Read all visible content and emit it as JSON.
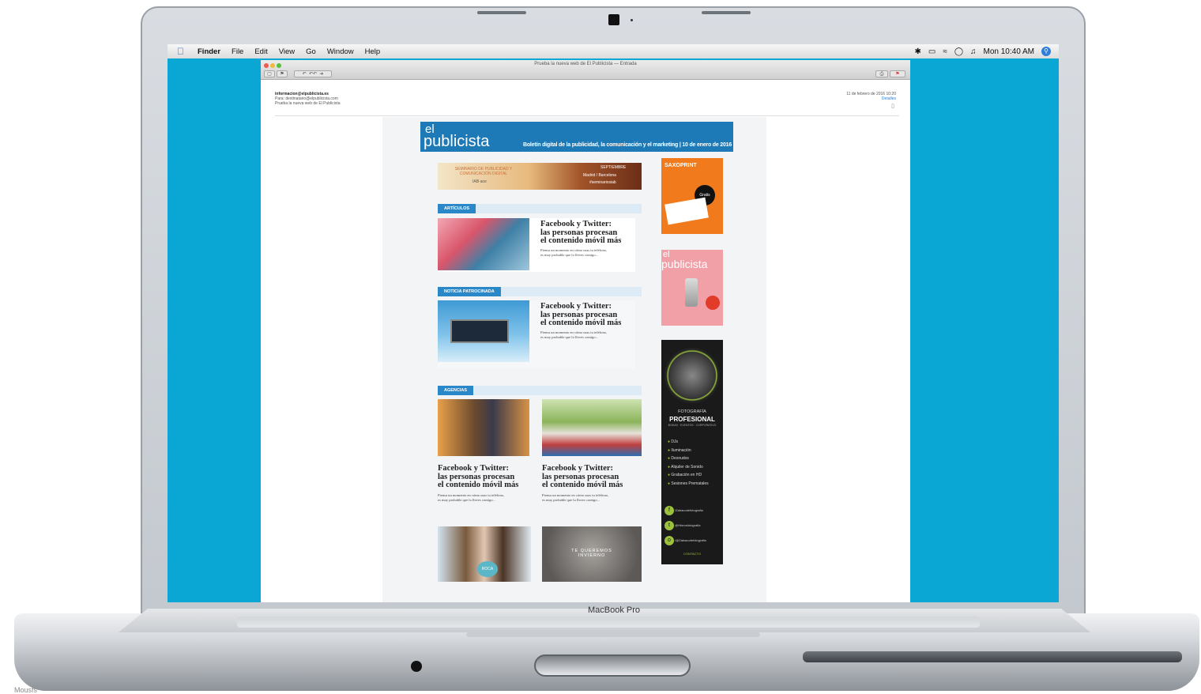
{
  "menubar": {
    "apple": "",
    "items": [
      "Finder",
      "File",
      "Edit",
      "View",
      "Go",
      "Window",
      "Help"
    ],
    "clock": "Mon 10:40 AM",
    "status_icons": [
      "bluetooth-icon",
      "battery-icon",
      "wifi-icon",
      "timemachine-icon",
      "volume-icon",
      "spotlight-icon"
    ]
  },
  "mail": {
    "window_title": "Prueba la nueva web de El Publicista — Entrada",
    "from": "informacion@elpublicista.es",
    "to": "Para: destinatario@elpublicista.com",
    "subject": "Prueba la nueva web de El Publicista",
    "date": "11 de febrero de 2016 10:20",
    "details_link": "Detalles"
  },
  "newsletter": {
    "logo_line1": "el",
    "logo_line2": "publicista",
    "tagline": "Boletín digital de la publicidad, la comunicación y el marketing | 10 de enero de 2016",
    "top_banner": {
      "left": "SEMINARIO DE PUBLICIDAD Y COMUNICACIÓN DIGITAL",
      "left_sub": "IAB·ace",
      "date": "SEPTIEMBRE",
      "cities": "Madrid / Barcelona",
      "hashtag": "#seminariosiab"
    },
    "sections": [
      {
        "label": "ARTÍCULOS"
      },
      {
        "label": "NOTICIA PATROCINADA"
      },
      {
        "label": "AGENCIAS"
      }
    ],
    "article_title": "Facebook y Twitter:\nlas personas procesan\nel contenido móvil más",
    "article_text": "Piensa un momento en cómo usas tu teléfono,\nes muy probable que lo lleves contigo..."
  },
  "ads": {
    "saxoprint": "SAXOPRINT",
    "saxo_badge": "Gratis",
    "elpublicista_ad_l1": "el",
    "elpublicista_ad_l2": "publicista",
    "photo_title1": "FOTOGRAFÍA",
    "photo_title2": "PROFESIONAL",
    "photo_sub": "BODAS · EVENTOS · CORPORATIVO",
    "photo_list": [
      "DJs",
      "Iluminación",
      "Desnudos",
      "Alquiler de Sonido",
      "Grabación en HD",
      "Sesiones Prematales"
    ],
    "photo_social": [
      "/Zabacodefotografia",
      "@Hbeosfotografia",
      "/@Zabacodefotografia"
    ],
    "photo_contact": "CONTACTO"
  },
  "images": {
    "winter_text": "TE QUEREMOS INVIERNO",
    "agency_badge": "ROCA"
  },
  "laptop": {
    "brand": "MacBook Pro",
    "footnote": "Mousfs"
  },
  "colors": {
    "desktop": "#0aa6d4",
    "newsletter_blue": "#1e7ab6",
    "section_label": "#2a88c9",
    "saxo_orange": "#f07a1c",
    "pink_ad": "#f2a0a8"
  }
}
